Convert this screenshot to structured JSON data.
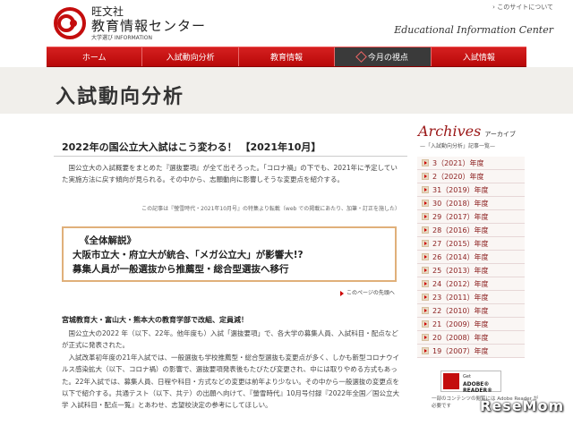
{
  "header": {
    "logo_line1": "旺文社",
    "logo_line2": "教育情報センター",
    "logo_line3": "大学選び INFORMATION",
    "site_link": "このサイトについて",
    "tagline": "Educational Information Center"
  },
  "nav": {
    "items": [
      {
        "label": "ホーム"
      },
      {
        "label": "入試動向分析"
      },
      {
        "label": "教育情報"
      },
      {
        "label": "今月の視点"
      },
      {
        "label": "入試情報"
      }
    ]
  },
  "page_title": "入試動向分析",
  "article": {
    "title": "2022年の国公立大入試はこう変わる！ 【2021年10月】",
    "intro": "国公立大の入試概要をまとめた『選抜要項』が全て出そろった。「コロナ禍」の下でも、2021年に予定していた実施方法に戻す傾向が見られる。その中から、志願動向に影響しそうな変更点を紹介する。",
    "source": "この記事は『螢雪時代・2021年10月号』の特集より転載（web での掲載にあたり、加筆・訂正を施した）",
    "box_line1": "《全体解説》",
    "box_line2": "大阪市立大・府立大が統合、「メガ公立大」が影響大!?",
    "box_line3": "募集人員が一般選抜から推薦型・総合型選抜へ移行",
    "pagetop": "このページの先頭へ",
    "sub_heading": "宮城教育大・富山大・熊本大の教育学部で改組、定員減！",
    "para1": "国公立大の2022 年（以下、22年。他年度も）入試「選抜要項」で、各大学の募集人員、入試科目・配点などが正式に発表された。",
    "para2": "入試改革初年度の21年入試では、一般選抜も学校推薦型・総合型選抜も変更点が多く、しかも新型コロナウイルス感染拡大（以下、コロナ禍）の影響で、選抜要項発表後もたびたび変更され、中には取りやめる方式もあった。22年入試では、募集人員、日程や科目・方式などの変更は前年より少ない。その中から一般選抜の変更点を以下で紹介する。共通テスト（以下、共テ）の出願へ向けて、『螢雪時代』10月号付録『2022年全国／国公立大学 入試科目・配点一覧』とあわせ、志望校決定の参考にしてほしい。"
  },
  "sidebar": {
    "archives_en": "Archives",
    "archives_ja": "アーカイブ",
    "archives_sub": "—「入試動向分析」記事一覧—",
    "items": [
      {
        "label": "3（2021）年度"
      },
      {
        "label": "2（2020）年度"
      },
      {
        "label": "31（2019）年度"
      },
      {
        "label": "30（2018）年度"
      },
      {
        "label": "29（2017）年度"
      },
      {
        "label": "28（2016）年度"
      },
      {
        "label": "27（2015）年度"
      },
      {
        "label": "26（2014）年度"
      },
      {
        "label": "25（2013）年度"
      },
      {
        "label": "24（2012）年度"
      },
      {
        "label": "23（2011）年度"
      },
      {
        "label": "22（2010）年度"
      },
      {
        "label": "21（2009）年度"
      },
      {
        "label": "20（2008）年度"
      },
      {
        "label": "19（2007）年度"
      }
    ],
    "adobe_get": "Get",
    "adobe_name": "ADOBE® READER®",
    "adobe_note": "一部のコンテンツの閲覧には Adobe Reader が必要です"
  },
  "watermark": "ReseMom",
  "colors": {
    "accent": "#c40d0d",
    "band": "#f1efeb",
    "archive": "#9a1616"
  }
}
